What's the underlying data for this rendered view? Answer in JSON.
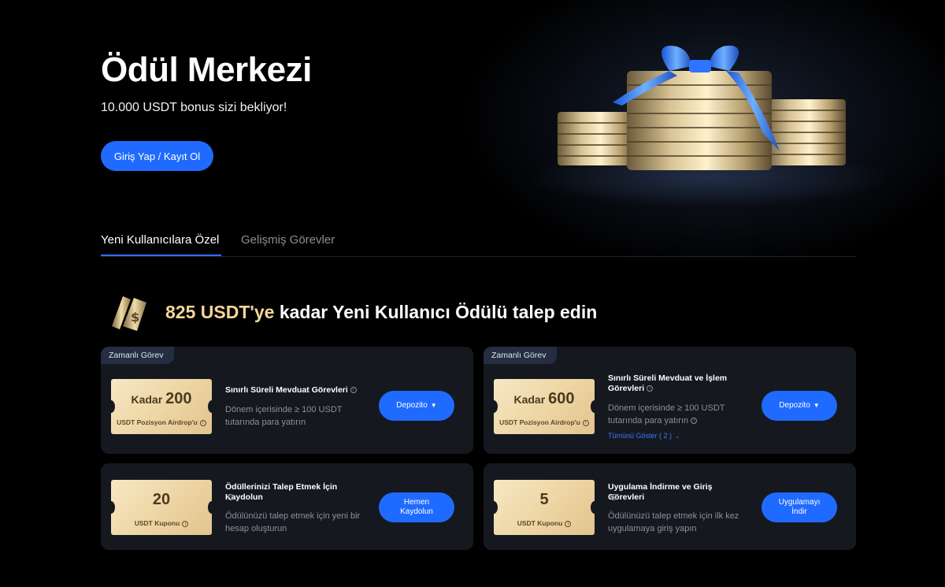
{
  "hero": {
    "title": "Ödül Merkezi",
    "subtitle": "10.000 USDT bonus sizi bekliyor!",
    "login_button": "Giriş Yap / Kayıt Ol"
  },
  "tabs": [
    {
      "label": "Yeni Kullanıcılara Özel",
      "active": true
    },
    {
      "label": "Gelişmiş Görevler",
      "active": false
    }
  ],
  "section": {
    "highlight": "825 USDT'ye",
    "heading_rest": " kadar Yeni Kullanıcı Ödülü talep edin"
  },
  "cards": [
    {
      "badge": "Zamanlı Görev",
      "ticket_prefix": "Kadar",
      "ticket_amount": "200",
      "ticket_label": "USDT Pozisyon Airdrop'u",
      "title": "Sınırlı Süreli Mevduat Görevleri",
      "desc": "Dönem içerisinde ≥ 100 USDT tutarında para yatırın",
      "button": "Depozito"
    },
    {
      "badge": "Zamanlı Görev",
      "ticket_prefix": "Kadar",
      "ticket_amount": "600",
      "ticket_label": "USDT Pozisyon Airdrop'u",
      "title": "Sınırlı Süreli Mevduat ve İşlem Görevleri",
      "desc": "Dönem içerisinde ≥ 100 USDT tutarında para yatırın",
      "link": "Tümünü Göster ( 2 )",
      "button": "Depozito"
    },
    {
      "ticket_amount": "20",
      "ticket_label": "USDT Kuponu",
      "title": "Ödüllerinizi Talep Etmek İçin Kaydolun",
      "desc": "Ödülünüzü talep etmek için yeni bir hesap oluşturun",
      "button_line1": "Hemen",
      "button_line2": "Kaydolun"
    },
    {
      "ticket_amount": "5",
      "ticket_label": "USDT Kuponu",
      "title": "Uygulama İndirme ve Giriş Görevleri",
      "desc": "Ödülünüzü talep etmek için ilk kez uygulamaya giriş yapın",
      "button_line1": "Uygulamayı",
      "button_line2": "İndir"
    }
  ],
  "colors": {
    "accent": "#1f6bff",
    "highlight": "#f4d69a",
    "card_bg": "#15181f"
  }
}
